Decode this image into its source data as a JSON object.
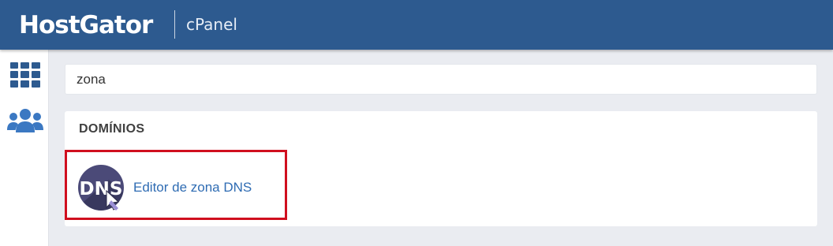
{
  "header": {
    "brand": "HostGator",
    "product": "cPanel"
  },
  "sidebar": {
    "items": [
      {
        "name": "tools-grid",
        "icon": "grid-icon"
      },
      {
        "name": "users",
        "icon": "users-icon"
      }
    ]
  },
  "search": {
    "value": "zona"
  },
  "section": {
    "title": "DOMÍNIOS",
    "results": [
      {
        "label": "Editor de zona DNS",
        "icon": "dns-icon",
        "icon_text": "DNS"
      }
    ]
  },
  "colors": {
    "header_bg": "#2d5a8f",
    "accent": "#2f6cb3",
    "sidebar_icon": "#2d5a8f",
    "highlight": "#d00f1f",
    "page_bg": "#eaecf1"
  }
}
